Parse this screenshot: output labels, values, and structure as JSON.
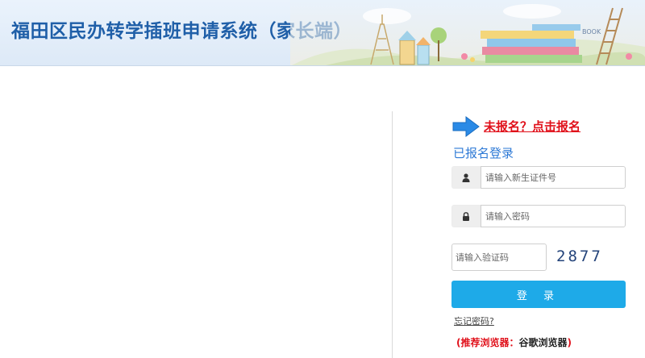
{
  "header": {
    "title": "福田区民办转学插班申请系统（家长端）",
    "decoration_text": "BOOK",
    "background_color": "#e4eefa",
    "title_color": "#1f5fa8"
  },
  "register": {
    "link_text": "未报名？点击报名",
    "link_color": "#e0101a",
    "arrow_icon": "arrow-right-icon",
    "arrow_color": "#2a8ae6"
  },
  "login": {
    "title": "已报名登录",
    "id_field": {
      "icon": "user-icon",
      "placeholder": "请输入新生证件号",
      "value": ""
    },
    "password_field": {
      "icon": "lock-icon",
      "placeholder": "请输入密码",
      "value": ""
    },
    "captcha_field": {
      "placeholder": "请输入验证码",
      "value": ""
    },
    "captcha_code": "2877",
    "submit_label": "登 录",
    "submit_color": "#1eaae8",
    "forgot_label": "忘记密码?"
  },
  "browser_note": {
    "prefix": "(推荐浏览器：",
    "browser": "谷歌浏览器",
    "suffix": ")"
  }
}
